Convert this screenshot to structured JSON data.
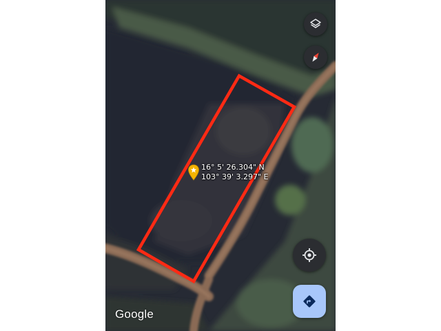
{
  "map": {
    "type": "satellite",
    "attribution": "Google",
    "pin": {
      "latitude": "16° 5' 26.304\" N",
      "longitude": "103° 39' 3.297\" E"
    },
    "boundary_color": "#ff2a14",
    "pin_color": "#f4b400"
  },
  "controls": {
    "layers": "layers-icon",
    "compass": "compass-icon",
    "locate": "my-location-icon",
    "directions": "directions-icon"
  }
}
